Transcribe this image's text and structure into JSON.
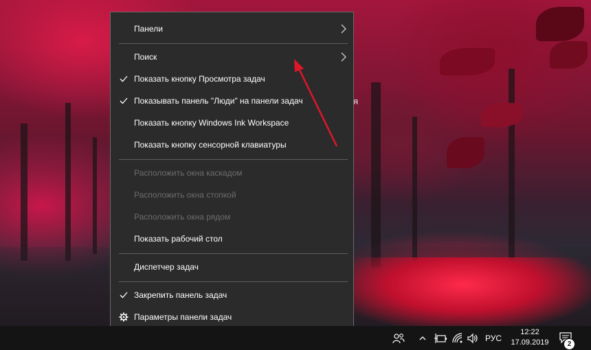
{
  "desktop": {
    "partial_text": "я"
  },
  "context_menu": {
    "items": [
      {
        "label": "Панели",
        "checked": false,
        "submenu": true,
        "disabled": false
      },
      {
        "label": "Поиск",
        "checked": false,
        "submenu": true,
        "disabled": false
      },
      {
        "label": "Показать кнопку Просмотра задач",
        "checked": true,
        "submenu": false,
        "disabled": false
      },
      {
        "label": "Показывать панель \"Люди\" на панели задач",
        "checked": true,
        "submenu": false,
        "disabled": false
      },
      {
        "label": "Показать кнопку Windows Ink Workspace",
        "checked": false,
        "submenu": false,
        "disabled": false
      },
      {
        "label": "Показать кнопку сенсорной клавиатуры",
        "checked": false,
        "submenu": false,
        "disabled": false
      },
      {
        "label": "Расположить окна каскадом",
        "checked": false,
        "submenu": false,
        "disabled": true
      },
      {
        "label": "Расположить окна стопкой",
        "checked": false,
        "submenu": false,
        "disabled": true
      },
      {
        "label": "Расположить окна рядом",
        "checked": false,
        "submenu": false,
        "disabled": true
      },
      {
        "label": "Показать рабочий стол",
        "checked": false,
        "submenu": false,
        "disabled": false
      },
      {
        "label": "Диспетчер задач",
        "checked": false,
        "submenu": false,
        "disabled": false
      },
      {
        "label": "Закрепить панель задач",
        "checked": true,
        "submenu": false,
        "disabled": false
      },
      {
        "label": "Параметры панели задач",
        "checked": false,
        "submenu": false,
        "disabled": false,
        "icon": "gear-icon"
      }
    ]
  },
  "taskbar": {
    "language": "РУС",
    "time": "12:22",
    "date": "17.09.2019",
    "notification_count": "2",
    "tray_icons": [
      "people-icon",
      "chevron-up-icon",
      "battery-icon",
      "wifi-icon",
      "volume-icon",
      "notification-icon"
    ]
  },
  "colors": {
    "menu_bg": "#2b2b2b",
    "menu_border": "#6a6a6a",
    "disabled_text": "#6d6d6d",
    "annotation_arrow": "#e0162b",
    "taskbar_bg": "#141414"
  }
}
